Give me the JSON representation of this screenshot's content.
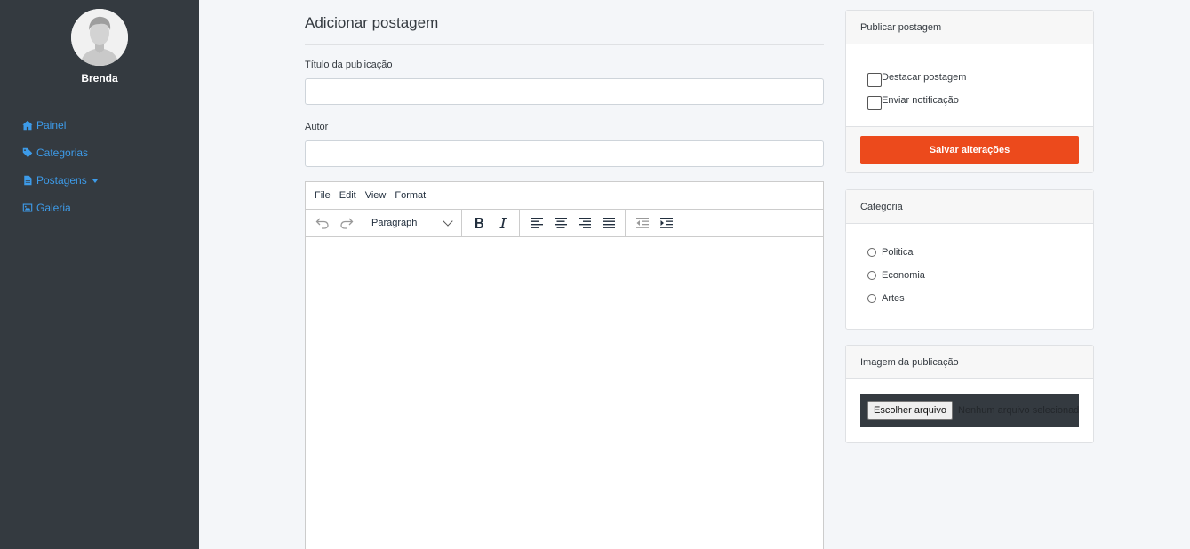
{
  "sidebar": {
    "user_name": "Brenda",
    "items": [
      {
        "label": "Painel",
        "icon": "home-icon"
      },
      {
        "label": "Categorias",
        "icon": "tag-icon"
      },
      {
        "label": "Postagens",
        "icon": "file-icon",
        "has_dropdown": true
      },
      {
        "label": "Galeria",
        "icon": "image-icon"
      }
    ]
  },
  "main": {
    "title": "Adicionar postagem",
    "title_field": {
      "label": "Título da publicação",
      "value": ""
    },
    "author_field": {
      "label": "Autor",
      "value": ""
    },
    "editor": {
      "menu": [
        "File",
        "Edit",
        "View",
        "Format"
      ],
      "block_format": "Paragraph",
      "toolbar_icons": [
        "undo-icon",
        "redo-icon",
        "bold-icon",
        "italic-icon",
        "align-left-icon",
        "align-center-icon",
        "align-right-icon",
        "justify-icon",
        "outdent-icon",
        "indent-icon"
      ]
    }
  },
  "publish_card": {
    "title": "Publicar postagem",
    "options": [
      "Destacar postagem",
      "Enviar notificação"
    ],
    "save_label": "Salvar alterações"
  },
  "category_card": {
    "title": "Categoria",
    "options": [
      "Politica",
      "Economia",
      "Artes"
    ]
  },
  "image_card": {
    "title": "Imagem da publicação",
    "choose_label": "Escolher arquivo",
    "status": "Nenhum arquivo selecionado"
  },
  "colors": {
    "sidebar_bg": "#343a40",
    "link": "#3d9be9",
    "save_button": "#ec4a1c",
    "page_bg": "#f4f6f9"
  }
}
